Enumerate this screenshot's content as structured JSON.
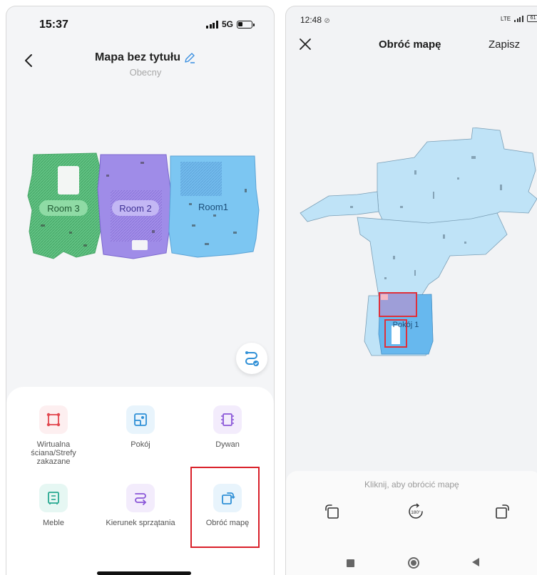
{
  "left": {
    "status": {
      "time": "15:37",
      "network": "5G"
    },
    "header": {
      "title": "Mapa bez tytułu",
      "subtitle": "Obecny"
    },
    "rooms": [
      {
        "name": "Room 3",
        "color": "#5cc37d"
      },
      {
        "name": "Room 2",
        "color": "#a08bea"
      },
      {
        "name": "Room1",
        "color": "#7cc8f2"
      }
    ],
    "tools": [
      {
        "label": "Wirtualna ściana/Strefy zakazane",
        "icon": "virtual-wall-icon",
        "color": "#e2474f"
      },
      {
        "label": "Pokój",
        "icon": "room-icon",
        "color": "#2e8fd6"
      },
      {
        "label": "Dywan",
        "icon": "carpet-icon",
        "color": "#8a56d8"
      },
      {
        "label": "Meble",
        "icon": "furniture-icon",
        "color": "#27a891"
      },
      {
        "label": "Kierunek sprzątania",
        "icon": "cleaning-direction-icon",
        "color": "#8a56d8"
      },
      {
        "label": "Obróć mapę",
        "icon": "rotate-map-icon",
        "color": "#2e8fd6"
      }
    ],
    "highlight_color": "#d9202a"
  },
  "right": {
    "status": {
      "time": "12:48",
      "battery": "61",
      "network": "LTE"
    },
    "header": {
      "title": "Obróć mapę",
      "save": "Zapisz"
    },
    "room_label": "Pokój 1",
    "hint": "Kliknij, aby obrócić mapę",
    "rotate_180_label": "180°",
    "map_color": "#bfe3f7"
  }
}
